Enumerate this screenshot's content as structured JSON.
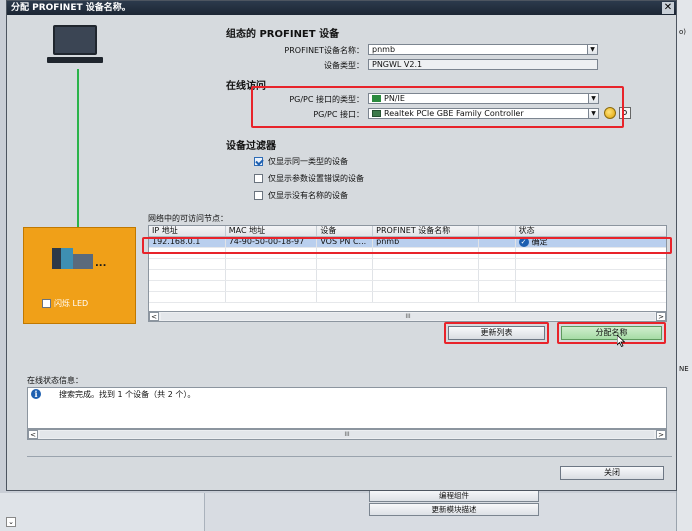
{
  "dialog": {
    "title": "分配 PROFINET 设备名称。",
    "close_glyph": "✕",
    "flash_led_label": "闪烁 LED"
  },
  "device_section": {
    "heading": "组态的 PROFINET 设备",
    "name_label": "PROFINET设备名称：",
    "name_value": "pnmb",
    "type_label": "设备类型：",
    "type_value": "PNGWL V2.1"
  },
  "online_section": {
    "heading": "在线访问",
    "pgpc_type_label": "PG/PC 接口的类型：",
    "pgpc_type_value": "PN/IE",
    "pgpc_iface_label": "PG/PC 接口：",
    "pgpc_iface_value": "Realtek PCIe GBE Family Controller"
  },
  "filter_section": {
    "heading": "设备过滤器",
    "options": [
      {
        "label": "仅显示同一类型的设备",
        "checked": true
      },
      {
        "label": "仅显示参数设置错误的设备",
        "checked": false
      },
      {
        "label": "仅显示没有名称的设备",
        "checked": false
      }
    ]
  },
  "nodes_table": {
    "caption": "网络中的可访问节点：",
    "columns": [
      "IP 地址",
      "MAC 地址",
      "设备",
      "PROFINET 设备名称",
      "",
      "状态"
    ],
    "rows": [
      {
        "ip": "192.168.0.1",
        "mac": "74-90-50-00-18-97",
        "device": "VOS PN C...",
        "pn_name": "pnmb",
        "extra": "",
        "status": "确定",
        "selected": true
      }
    ],
    "scroll_thumb": "III"
  },
  "buttons": {
    "update_list": "更新列表",
    "assign_name": "分配名称",
    "close": "关闭"
  },
  "status": {
    "caption": "在线状态信息：",
    "messages": [
      "搜索完成。找到 1 个设备（共 2 个）。"
    ],
    "scroll_thumb": "III"
  },
  "background": {
    "right_fragment_1": "o)",
    "right_fragment_2": "NE",
    "btn_top": "编程组件",
    "btn_bottom": "更新模块描述"
  },
  "colors": {
    "highlight_red": "#e8232a",
    "network_green": "#2bb34a",
    "device_orange": "#f0a018",
    "title_bar": "#1c2634",
    "selection_blue": "#b9cfee"
  }
}
